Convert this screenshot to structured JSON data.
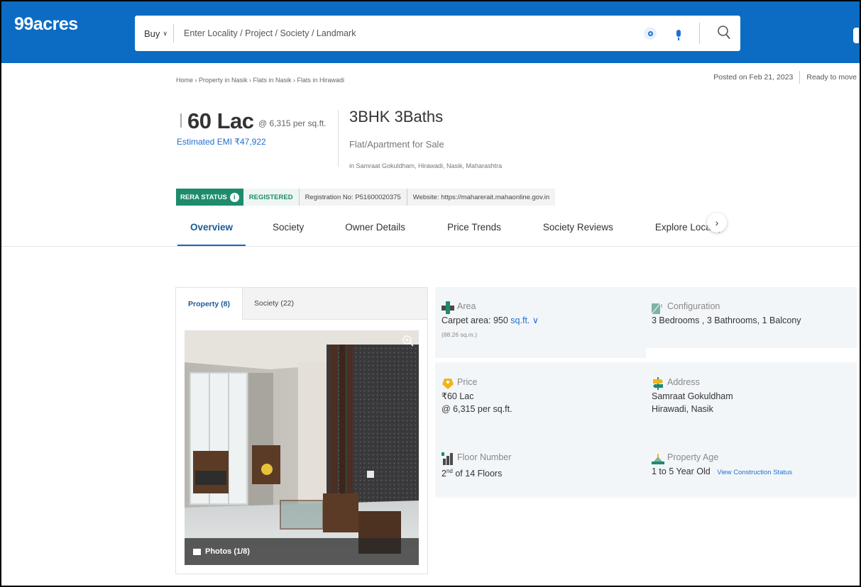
{
  "header": {
    "logo": "99acres",
    "search": {
      "mode": "Buy",
      "placeholder": "Enter Locality / Project / Society / Landmark"
    }
  },
  "breadcrumb": "Home › Property in Nasik › Flats in Nasik › Flats in Hirawadi",
  "posted": {
    "date": "Posted on Feb 21, 2023",
    "status": "Ready to move"
  },
  "listing": {
    "price": "60 Lac",
    "price_per": "@ 6,315 per sq.ft.",
    "emi": "Estimated EMI ₹47,922",
    "title": "3BHK 3Baths",
    "subtitle": "Flat/Apartment for Sale",
    "locality": "in Samraat Gokuldham, Hirawadi, Nasik, Maharashtra"
  },
  "rera": {
    "badge": "RERA STATUS",
    "info": "i",
    "status": "REGISTERED",
    "registration": "Registration No: P51600020375",
    "website": "Website: https://maharerait.mahaonline.gov.in"
  },
  "tabs": [
    {
      "label": "Overview"
    },
    {
      "label": "Society"
    },
    {
      "label": "Owner Details"
    },
    {
      "label": "Price Trends"
    },
    {
      "label": "Society Reviews"
    },
    {
      "label": "Explore Locality"
    }
  ],
  "tab_next": "›",
  "gallery": {
    "tab_property": "Property (8)",
    "tab_society": "Society (22)",
    "photos_label": "Photos (1/8)"
  },
  "details": {
    "area": {
      "label": "Area",
      "value": "Carpet area: 950",
      "unit": "sq.ft.",
      "unit_chev": "∨",
      "note": "(88.26 sq.m.)"
    },
    "configuration": {
      "label": "Configuration",
      "value": "3 Bedrooms , 3 Bathrooms, 1 Balcony"
    },
    "price": {
      "label": "Price",
      "value": "₹60 Lac",
      "per": "@ 6,315 per sq.ft."
    },
    "address": {
      "label": "Address",
      "line1": "Samraat Gokuldham",
      "line2": "Hirawadi, Nasik"
    },
    "floor": {
      "label": "Floor Number",
      "floor_num": "2",
      "floor_sup": "nd",
      "floor_of": "of 14 Floors"
    },
    "age": {
      "label": "Property Age",
      "value": "1 to 5 Year Old",
      "link": "View Construction Status"
    }
  },
  "colors": {
    "header_blue": "#0c6cc4",
    "link_blue": "#1f6fd1",
    "rera_green": "#1d8b6c"
  }
}
